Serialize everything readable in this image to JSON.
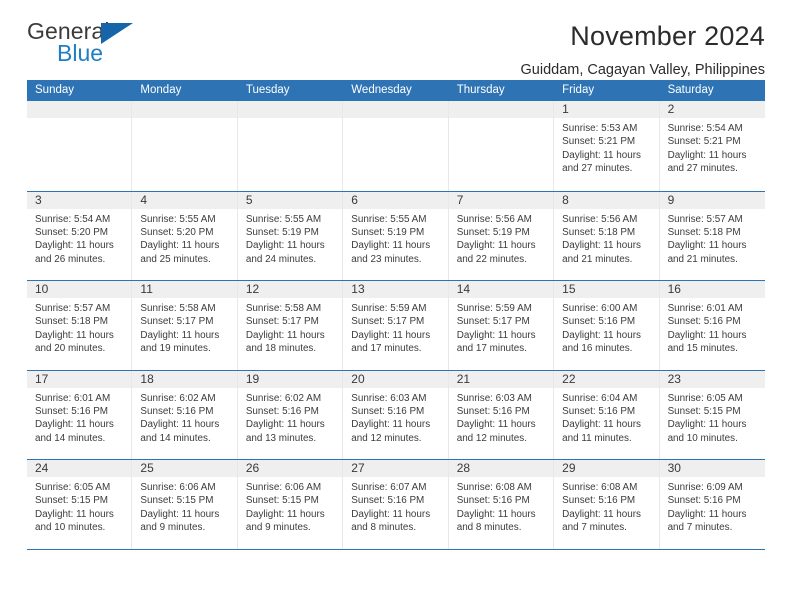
{
  "brand": {
    "name_part1": "General",
    "name_part2": "Blue",
    "triangle_color": "#1565a8",
    "blue_color": "#1f7ec4"
  },
  "header": {
    "title": "November 2024",
    "subtitle": "Guiddam, Cagayan Valley, Philippines",
    "header_bg": "#2e74b5",
    "daynum_bg": "#efefef"
  },
  "weekdays": [
    "Sunday",
    "Monday",
    "Tuesday",
    "Wednesday",
    "Thursday",
    "Friday",
    "Saturday"
  ],
  "labels": {
    "sunrise_prefix": "Sunrise:",
    "sunset_prefix": "Sunset:",
    "daylight_prefix": "Daylight:"
  },
  "weeks": [
    [
      {
        "empty": true
      },
      {
        "empty": true
      },
      {
        "empty": true
      },
      {
        "empty": true
      },
      {
        "empty": true
      },
      {
        "day": "1",
        "sunrise": "Sunrise: 5:53 AM",
        "sunset": "Sunset: 5:21 PM",
        "daylight_l1": "Daylight: 11 hours",
        "daylight_l2": "and 27 minutes."
      },
      {
        "day": "2",
        "sunrise": "Sunrise: 5:54 AM",
        "sunset": "Sunset: 5:21 PM",
        "daylight_l1": "Daylight: 11 hours",
        "daylight_l2": "and 27 minutes."
      }
    ],
    [
      {
        "day": "3",
        "sunrise": "Sunrise: 5:54 AM",
        "sunset": "Sunset: 5:20 PM",
        "daylight_l1": "Daylight: 11 hours",
        "daylight_l2": "and 26 minutes."
      },
      {
        "day": "4",
        "sunrise": "Sunrise: 5:55 AM",
        "sunset": "Sunset: 5:20 PM",
        "daylight_l1": "Daylight: 11 hours",
        "daylight_l2": "and 25 minutes."
      },
      {
        "day": "5",
        "sunrise": "Sunrise: 5:55 AM",
        "sunset": "Sunset: 5:19 PM",
        "daylight_l1": "Daylight: 11 hours",
        "daylight_l2": "and 24 minutes."
      },
      {
        "day": "6",
        "sunrise": "Sunrise: 5:55 AM",
        "sunset": "Sunset: 5:19 PM",
        "daylight_l1": "Daylight: 11 hours",
        "daylight_l2": "and 23 minutes."
      },
      {
        "day": "7",
        "sunrise": "Sunrise: 5:56 AM",
        "sunset": "Sunset: 5:19 PM",
        "daylight_l1": "Daylight: 11 hours",
        "daylight_l2": "and 22 minutes."
      },
      {
        "day": "8",
        "sunrise": "Sunrise: 5:56 AM",
        "sunset": "Sunset: 5:18 PM",
        "daylight_l1": "Daylight: 11 hours",
        "daylight_l2": "and 21 minutes."
      },
      {
        "day": "9",
        "sunrise": "Sunrise: 5:57 AM",
        "sunset": "Sunset: 5:18 PM",
        "daylight_l1": "Daylight: 11 hours",
        "daylight_l2": "and 21 minutes."
      }
    ],
    [
      {
        "day": "10",
        "sunrise": "Sunrise: 5:57 AM",
        "sunset": "Sunset: 5:18 PM",
        "daylight_l1": "Daylight: 11 hours",
        "daylight_l2": "and 20 minutes."
      },
      {
        "day": "11",
        "sunrise": "Sunrise: 5:58 AM",
        "sunset": "Sunset: 5:17 PM",
        "daylight_l1": "Daylight: 11 hours",
        "daylight_l2": "and 19 minutes."
      },
      {
        "day": "12",
        "sunrise": "Sunrise: 5:58 AM",
        "sunset": "Sunset: 5:17 PM",
        "daylight_l1": "Daylight: 11 hours",
        "daylight_l2": "and 18 minutes."
      },
      {
        "day": "13",
        "sunrise": "Sunrise: 5:59 AM",
        "sunset": "Sunset: 5:17 PM",
        "daylight_l1": "Daylight: 11 hours",
        "daylight_l2": "and 17 minutes."
      },
      {
        "day": "14",
        "sunrise": "Sunrise: 5:59 AM",
        "sunset": "Sunset: 5:17 PM",
        "daylight_l1": "Daylight: 11 hours",
        "daylight_l2": "and 17 minutes."
      },
      {
        "day": "15",
        "sunrise": "Sunrise: 6:00 AM",
        "sunset": "Sunset: 5:16 PM",
        "daylight_l1": "Daylight: 11 hours",
        "daylight_l2": "and 16 minutes."
      },
      {
        "day": "16",
        "sunrise": "Sunrise: 6:01 AM",
        "sunset": "Sunset: 5:16 PM",
        "daylight_l1": "Daylight: 11 hours",
        "daylight_l2": "and 15 minutes."
      }
    ],
    [
      {
        "day": "17",
        "sunrise": "Sunrise: 6:01 AM",
        "sunset": "Sunset: 5:16 PM",
        "daylight_l1": "Daylight: 11 hours",
        "daylight_l2": "and 14 minutes."
      },
      {
        "day": "18",
        "sunrise": "Sunrise: 6:02 AM",
        "sunset": "Sunset: 5:16 PM",
        "daylight_l1": "Daylight: 11 hours",
        "daylight_l2": "and 14 minutes."
      },
      {
        "day": "19",
        "sunrise": "Sunrise: 6:02 AM",
        "sunset": "Sunset: 5:16 PM",
        "daylight_l1": "Daylight: 11 hours",
        "daylight_l2": "and 13 minutes."
      },
      {
        "day": "20",
        "sunrise": "Sunrise: 6:03 AM",
        "sunset": "Sunset: 5:16 PM",
        "daylight_l1": "Daylight: 11 hours",
        "daylight_l2": "and 12 minutes."
      },
      {
        "day": "21",
        "sunrise": "Sunrise: 6:03 AM",
        "sunset": "Sunset: 5:16 PM",
        "daylight_l1": "Daylight: 11 hours",
        "daylight_l2": "and 12 minutes."
      },
      {
        "day": "22",
        "sunrise": "Sunrise: 6:04 AM",
        "sunset": "Sunset: 5:16 PM",
        "daylight_l1": "Daylight: 11 hours",
        "daylight_l2": "and 11 minutes."
      },
      {
        "day": "23",
        "sunrise": "Sunrise: 6:05 AM",
        "sunset": "Sunset: 5:15 PM",
        "daylight_l1": "Daylight: 11 hours",
        "daylight_l2": "and 10 minutes."
      }
    ],
    [
      {
        "day": "24",
        "sunrise": "Sunrise: 6:05 AM",
        "sunset": "Sunset: 5:15 PM",
        "daylight_l1": "Daylight: 11 hours",
        "daylight_l2": "and 10 minutes."
      },
      {
        "day": "25",
        "sunrise": "Sunrise: 6:06 AM",
        "sunset": "Sunset: 5:15 PM",
        "daylight_l1": "Daylight: 11 hours",
        "daylight_l2": "and 9 minutes."
      },
      {
        "day": "26",
        "sunrise": "Sunrise: 6:06 AM",
        "sunset": "Sunset: 5:15 PM",
        "daylight_l1": "Daylight: 11 hours",
        "daylight_l2": "and 9 minutes."
      },
      {
        "day": "27",
        "sunrise": "Sunrise: 6:07 AM",
        "sunset": "Sunset: 5:16 PM",
        "daylight_l1": "Daylight: 11 hours",
        "daylight_l2": "and 8 minutes."
      },
      {
        "day": "28",
        "sunrise": "Sunrise: 6:08 AM",
        "sunset": "Sunset: 5:16 PM",
        "daylight_l1": "Daylight: 11 hours",
        "daylight_l2": "and 8 minutes."
      },
      {
        "day": "29",
        "sunrise": "Sunrise: 6:08 AM",
        "sunset": "Sunset: 5:16 PM",
        "daylight_l1": "Daylight: 11 hours",
        "daylight_l2": "and 7 minutes."
      },
      {
        "day": "30",
        "sunrise": "Sunrise: 6:09 AM",
        "sunset": "Sunset: 5:16 PM",
        "daylight_l1": "Daylight: 11 hours",
        "daylight_l2": "and 7 minutes."
      }
    ]
  ]
}
